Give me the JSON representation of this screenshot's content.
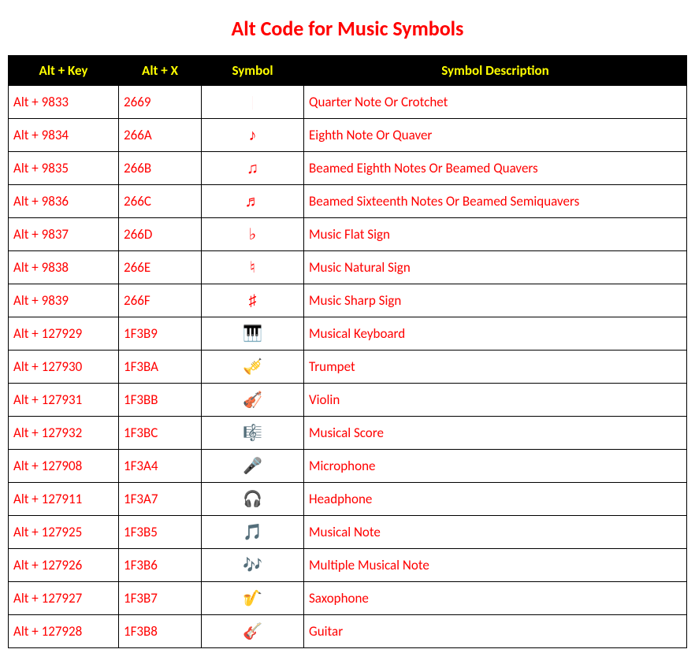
{
  "title": "Alt Code for Music Symbols",
  "headers": {
    "alt_key": "Alt + Key",
    "alt_x": "Alt + X",
    "symbol": "Symbol",
    "description": "Symbol Description"
  },
  "rows": [
    {
      "alt_key": "Alt + 9833",
      "alt_x": "2669",
      "symbol": "♩",
      "description": "Quarter Note Or Crotchet"
    },
    {
      "alt_key": "Alt + 9834",
      "alt_x": "266A",
      "symbol": "♪",
      "description": "Eighth Note Or Quaver"
    },
    {
      "alt_key": "Alt + 9835",
      "alt_x": "266B",
      "symbol": "♫",
      "description": "Beamed Eighth Notes Or Beamed Quavers"
    },
    {
      "alt_key": "Alt + 9836",
      "alt_x": "266C",
      "symbol": "♬",
      "description": "Beamed Sixteenth Notes Or Beamed Semiquavers"
    },
    {
      "alt_key": "Alt + 9837",
      "alt_x": "266D",
      "symbol": "♭",
      "description": "Music Flat Sign"
    },
    {
      "alt_key": "Alt + 9838",
      "alt_x": "266E",
      "symbol": "♮",
      "description": "Music Natural Sign"
    },
    {
      "alt_key": "Alt + 9839",
      "alt_x": "266F",
      "symbol": "♯",
      "description": "Music Sharp Sign"
    },
    {
      "alt_key": "Alt + 127929",
      "alt_x": "1F3B9",
      "symbol": "🎹",
      "description": "Musical Keyboard"
    },
    {
      "alt_key": "Alt + 127930",
      "alt_x": "1F3BA",
      "symbol": "🎺",
      "description": "Trumpet"
    },
    {
      "alt_key": "Alt + 127931",
      "alt_x": "1F3BB",
      "symbol": "🎻",
      "description": "Violin"
    },
    {
      "alt_key": "Alt + 127932",
      "alt_x": "1F3BC",
      "symbol": "🎼",
      "description": "Musical Score"
    },
    {
      "alt_key": "Alt + 127908",
      "alt_x": "1F3A4",
      "symbol": "🎤",
      "description": "Microphone"
    },
    {
      "alt_key": "Alt + 127911",
      "alt_x": "1F3A7",
      "symbol": "🎧",
      "description": "Headphone"
    },
    {
      "alt_key": "Alt + 127925",
      "alt_x": "1F3B5",
      "symbol": "🎵",
      "description": "Musical Note"
    },
    {
      "alt_key": "Alt + 127926",
      "alt_x": "1F3B6",
      "symbol": "🎶",
      "description": "Multiple Musical Note"
    },
    {
      "alt_key": "Alt + 127927",
      "alt_x": "1F3B7",
      "symbol": "🎷",
      "description": "Saxophone"
    },
    {
      "alt_key": "Alt + 127928",
      "alt_x": "1F3B8",
      "symbol": "🎸",
      "description": "Guitar"
    }
  ]
}
